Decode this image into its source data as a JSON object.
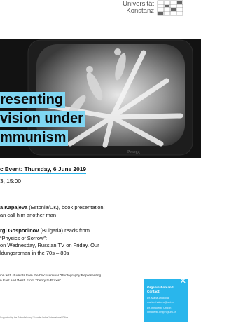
{
  "university": {
    "name_line1": "Universität",
    "name_line2": "Konstanz"
  },
  "title": {
    "line1": "resenting",
    "line2": "vision under",
    "line3": "mmunism"
  },
  "event": {
    "heading": "c Event: Thursday, 6 June 2019",
    "time": "3, 15:00"
  },
  "program": [
    {
      "bold": "a Kapajeva",
      "rest1": " (Estonia/UK), book presentation:",
      "line2": "an call him another man"
    },
    {
      "bold": "rgi Gospodinov",
      "rest1": " (Bulgaria) reads from",
      "line2": "“Physics of Sorrow”:",
      "line3": "on Wednesday, Russian TV on Friday. Our",
      "line4": "ldungsroman in the 70s – 80s"
    }
  ],
  "footnote": {
    "line1": "ion with students from the blockseminar “Photography Representing",
    "line2": "n East and West: From Theory to Praxis”"
  },
  "support_text": "Supported by the Zukunftskolleg “Transfer Lehre” International Office",
  "org_box": {
    "close": "✕",
    "title1": "Organization and",
    "title2": "Contact:",
    "contact1": "Dr. Maria Zhukova",
    "contact2": "maria.zhukova@uni-kn",
    "contact3": "Dr. Innokentij Urupin",
    "contact4": "innokentij.urupin@uni-kn"
  },
  "colors": {
    "accent": "#29b6ec",
    "title_highlight": "#7fd6f2"
  },
  "hero_image": "black-and-white photo of an old television screen showing figures"
}
